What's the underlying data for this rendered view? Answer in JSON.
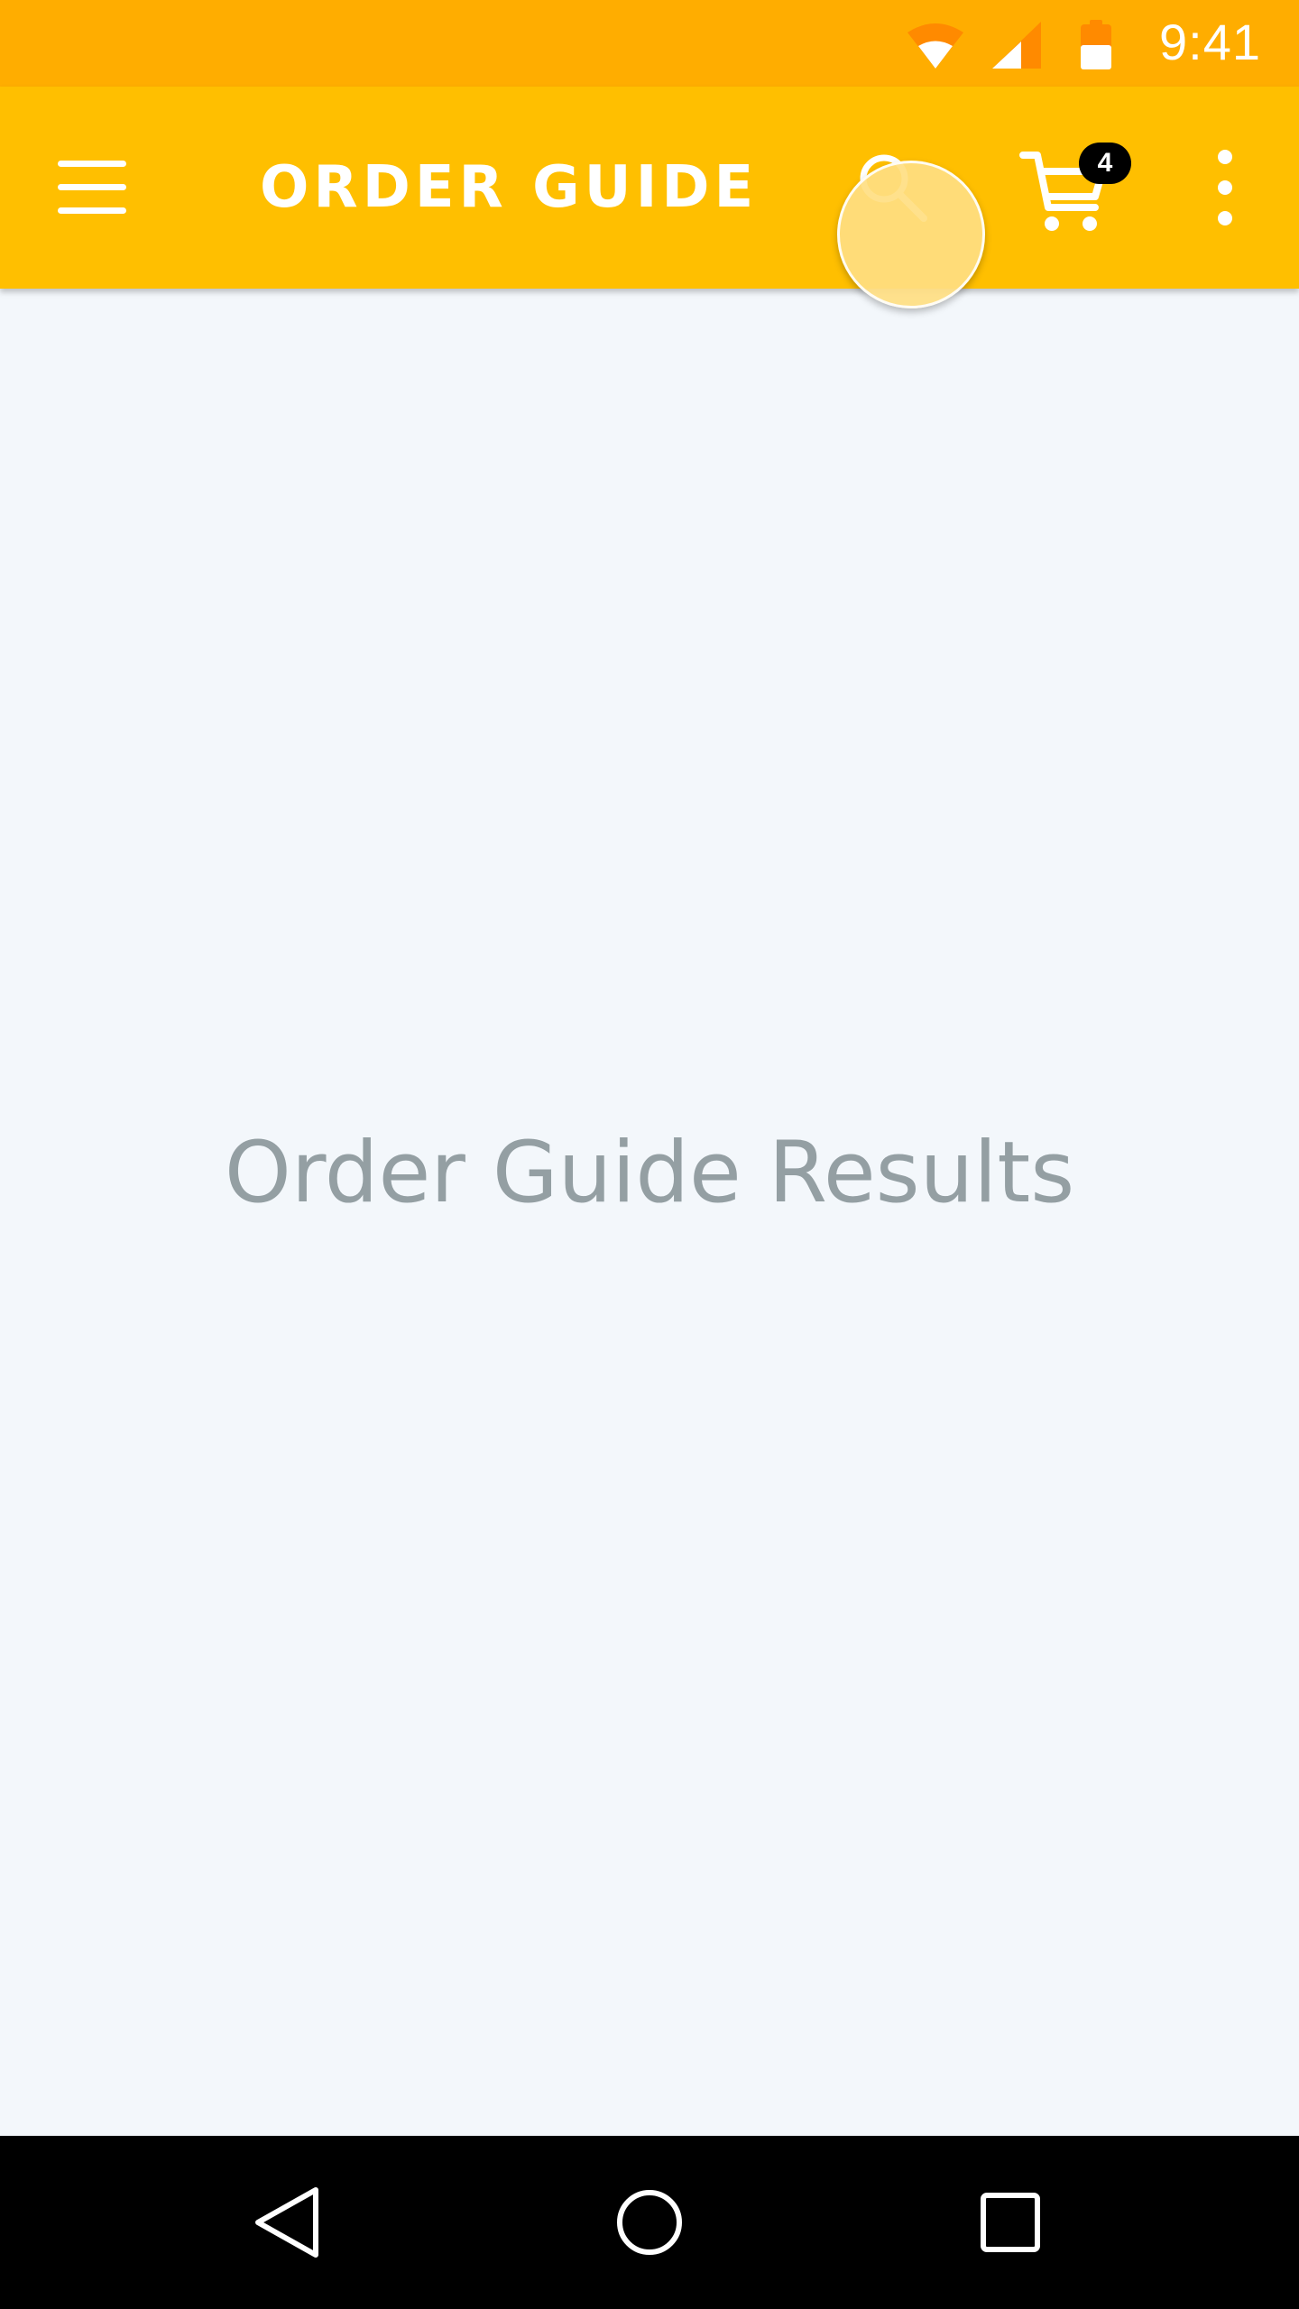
{
  "status_bar": {
    "time": "9:41",
    "icons": [
      "wifi-icon",
      "signal-icon",
      "battery-icon"
    ]
  },
  "app_bar": {
    "title": "ORDER GUIDE",
    "cart_count": "4",
    "icons": [
      "menu-icon",
      "search-icon",
      "cart-icon",
      "more-vert-icon"
    ]
  },
  "main": {
    "placeholder_text": "Order Guide Results"
  },
  "nav_bar": {
    "icons": [
      "back-icon",
      "home-icon",
      "recents-icon"
    ]
  },
  "colors": {
    "status_bar": "#ffad00",
    "app_bar": "#ffbf00",
    "background": "#f3f7fb",
    "placeholder_text": "#949fa3",
    "badge": "#000000"
  }
}
